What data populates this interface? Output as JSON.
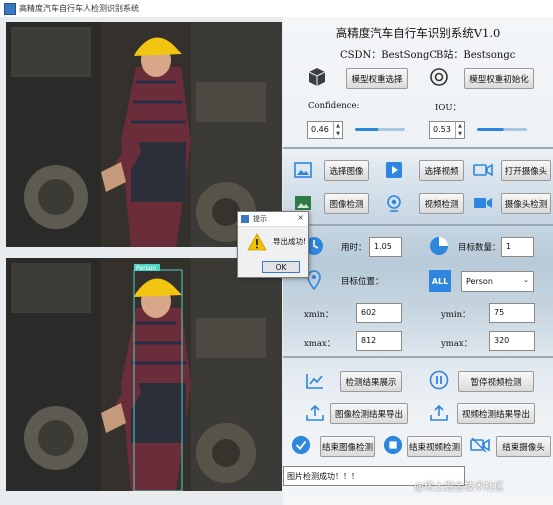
{
  "window": {
    "title": "高精度汽车自行车人检测识别系统"
  },
  "header": {
    "title": "高精度汽车自行车识别系统V1.0",
    "csdn": "CSDN：BestSongC",
    "bilibili": "B站：Bestsongc"
  },
  "model": {
    "select_label": "模型权重选择",
    "init_label": "模型权重初始化",
    "confidence_label": "Confidence:",
    "iou_label": "IOU：",
    "confidence_value": "0.46",
    "iou_value": "0.53",
    "confidence_level": 0.46,
    "iou_level": 0.53
  },
  "io": {
    "select_image": "选择图像",
    "select_video": "选择视频",
    "open_camera": "打开摄像头",
    "image_detect": "图像检测",
    "video_detect": "视频检测",
    "camera_detect": "摄像头检测"
  },
  "results": {
    "time_label": "用时：",
    "time_value": "1.05",
    "count_label": "目标数量：",
    "count_value": "1",
    "position_label": "目标位置：",
    "target_select": "Person",
    "xmin_label": "xmin：",
    "xmin_value": "602",
    "ymin_label": "ymin：",
    "ymin_value": "75",
    "xmax_label": "xmax：",
    "xmax_value": "812",
    "ymax_label": "ymax：",
    "ymax_value": "320"
  },
  "actions": {
    "show_results": "检测结果展示",
    "pause_video": "暂停视频检测",
    "export_image": "图像检测结果导出",
    "export_video": "视频检测结果导出",
    "end_image": "结束图像检测",
    "end_video": "结束视频检测",
    "end_camera": "结束摄像头"
  },
  "status": {
    "message": "图片检测成功！！！"
  },
  "dialog": {
    "title": "提示",
    "message": "导出成功!",
    "ok": "OK",
    "close": "×"
  },
  "watermark": "@稀土掘金技术社区",
  "detection": {
    "label": "Person"
  },
  "colors": {
    "accent": "#2e86de",
    "box": "#4fd5c7",
    "warning": "#f5c400"
  }
}
